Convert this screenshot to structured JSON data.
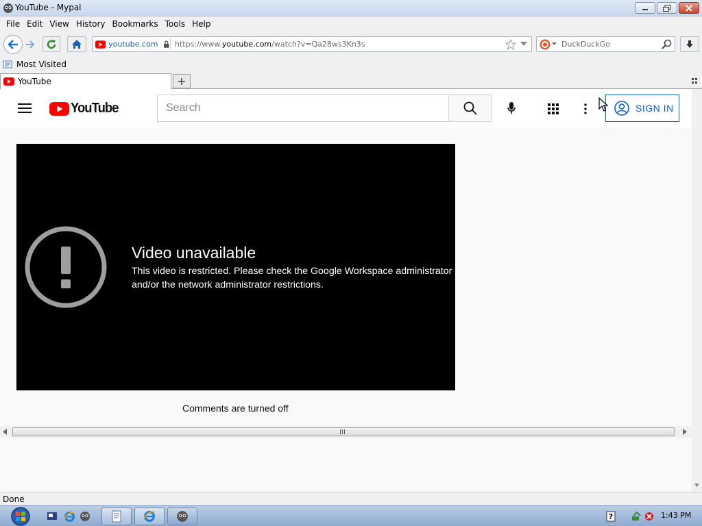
{
  "window": {
    "title": "YouTube - Mypal"
  },
  "menu": [
    "File",
    "Edit",
    "View",
    "History",
    "Bookmarks",
    "Tools",
    "Help"
  ],
  "nav": {
    "identity_domain": "youtube.com",
    "url_prefix": "https://www.",
    "url_host": "youtube.com",
    "url_path": "/watch?v=Qa28ws3Kn3s",
    "search_engine": "DuckDuckGo"
  },
  "bookmarks": {
    "most_visited": "Most Visited"
  },
  "tabs": {
    "active": "YouTube",
    "new_tab": "+"
  },
  "youtube": {
    "logo_text": "YouTube",
    "search_placeholder": "Search",
    "sign_in": "SIGN IN"
  },
  "player": {
    "error_title": "Video unavailable",
    "error_message": "This video is restricted. Please check the Google Workspace administrator and/or the network administrator restrictions."
  },
  "comments": "Comments are turned off",
  "status": "Done",
  "taskbar": {
    "clock": "1:43 PM"
  },
  "colors": {
    "youtube_red": "#ff0000",
    "signin_blue": "#065fd4",
    "player_bg": "#000000"
  }
}
